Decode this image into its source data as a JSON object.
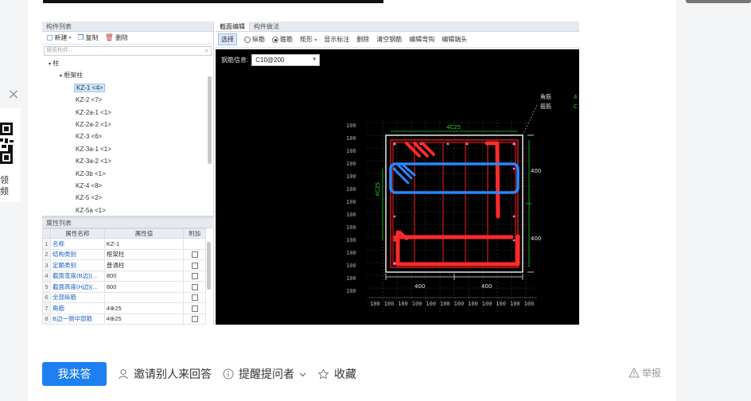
{
  "left_panel": {
    "close_glyph": "×",
    "text_line1": "领",
    "text_line2": "频"
  },
  "software": {
    "component_list_title": "构件列表",
    "toolbar": {
      "new_label": "新建",
      "copy_label": "复制",
      "delete_label": "删除"
    },
    "search_placeholder": "搜索构件...",
    "tree": {
      "root": "柱",
      "group": "框架柱",
      "items": [
        "KZ-1 <4>",
        "KZ-2 <7>",
        "KZ-2a-1 <1>",
        "KZ-2a-2 <1>",
        "KZ-3 <6>",
        "KZ-3a-1 <1>",
        "KZ-3a-2 <1>",
        "KZ-3b <1>",
        "KZ-4 <8>",
        "KZ-5 <2>",
        "KZ-5a <1>"
      ],
      "selected_index": 0
    },
    "property_list_title": "属性列表",
    "property_headers": [
      "属性名称",
      "属性值",
      "附加"
    ],
    "properties": [
      {
        "num": "1",
        "name": "名称",
        "value": "KZ-1",
        "has_check": false
      },
      {
        "num": "2",
        "name": "结构类别",
        "value": "框架柱",
        "has_check": true
      },
      {
        "num": "3",
        "name": "定额类别",
        "value": "普通柱",
        "has_check": true
      },
      {
        "num": "4",
        "name": "截面宽度(B边)(...",
        "value": "800",
        "has_check": true
      },
      {
        "num": "5",
        "name": "截面高度(H边)(...",
        "value": "800",
        "has_check": true
      },
      {
        "num": "6",
        "name": "全部纵筋",
        "value": "",
        "has_check": true
      },
      {
        "num": "7",
        "name": "角筋",
        "value": "4⊕25",
        "has_check": true
      },
      {
        "num": "8",
        "name": "B边一侧中部筋",
        "value": "4⊕25",
        "has_check": true
      }
    ],
    "editor_tabs": [
      "截面编辑",
      "构件做法"
    ],
    "active_tab": 0,
    "editor_toolbar": {
      "select": "选择",
      "longitudinal": "纵筋",
      "stirrup": "箍筋",
      "rect": "矩形",
      "show_label": "显示标注",
      "delete": "删除",
      "clear_rebar": "清空钢筋",
      "edit_hook": "编辑弯钩",
      "edit_end": "编辑端头"
    },
    "rebar_info_label": "钢筋信息:",
    "rebar_info_value": "C10@200",
    "drawing": {
      "legend_corner": "角筋",
      "legend_stirrup": "箍筋",
      "legend_corner_value": "4",
      "legend_stirrup_value": "C",
      "top_label": "4C25",
      "left_label": "4C25",
      "dim_right_top": "400",
      "dim_right_bottom": "400",
      "dim_bottom_left": "400",
      "dim_bottom_right": "400",
      "grid_label": "100",
      "bottom_ruler": [
        "100",
        "100",
        "100",
        "100",
        "100",
        "100",
        "100",
        "100",
        "100",
        "100",
        "100",
        "100"
      ]
    }
  },
  "actions": {
    "answer_button": "我来答",
    "invite": "邀请别人来回答",
    "remind": "提醒提问者",
    "favorite": "收藏",
    "report": "举报"
  },
  "colors": {
    "primary": "#1e7ff0",
    "red_markup": "#ff2a2a",
    "blue_markup": "#2a86ff",
    "green_dim": "#1fd11f"
  }
}
